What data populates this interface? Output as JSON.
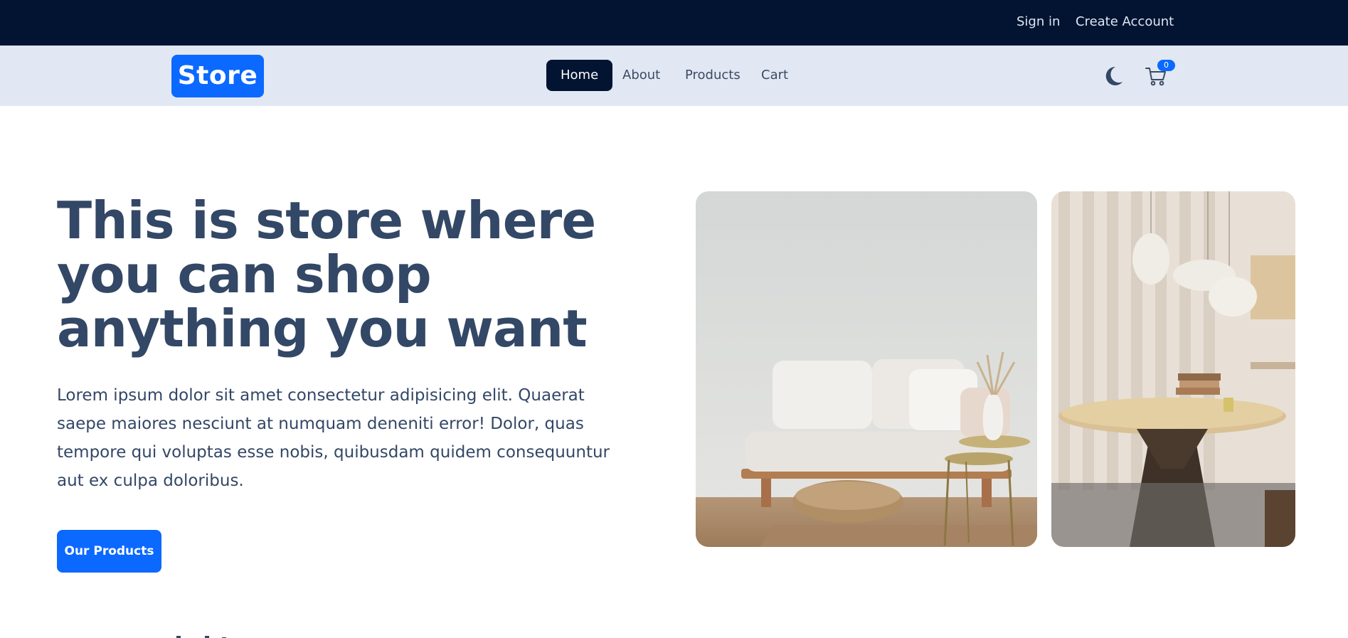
{
  "topbar": {
    "sign_in": "Sign in",
    "create_account": "Create Account"
  },
  "navbar": {
    "logo": "Store",
    "links": [
      "Home",
      "About",
      "Products",
      "Cart"
    ],
    "active_link": "Home",
    "theme_icon": "moon-icon",
    "cart_icon": "cart-icon",
    "cart_count": "0"
  },
  "hero": {
    "title": "This is store where you can shop anything you want",
    "description": "Lorem ipsum dolor sit amet consectetur adipisicing elit. Quaerat saepe maiores nesciunt at numquam deneniti error! Dolor, quas tempore qui voluptas esse nobis, quibusdam quidem consequuntur aut ex culpa doloribus.",
    "cta": "Our Products",
    "images": [
      "living-room-sofa-image",
      "dining-table-lamps-image"
    ]
  },
  "colors": {
    "topbar": "#021431",
    "navbar": "#e1e8f4",
    "primary": "#0b69ff",
    "text": "#334766"
  }
}
